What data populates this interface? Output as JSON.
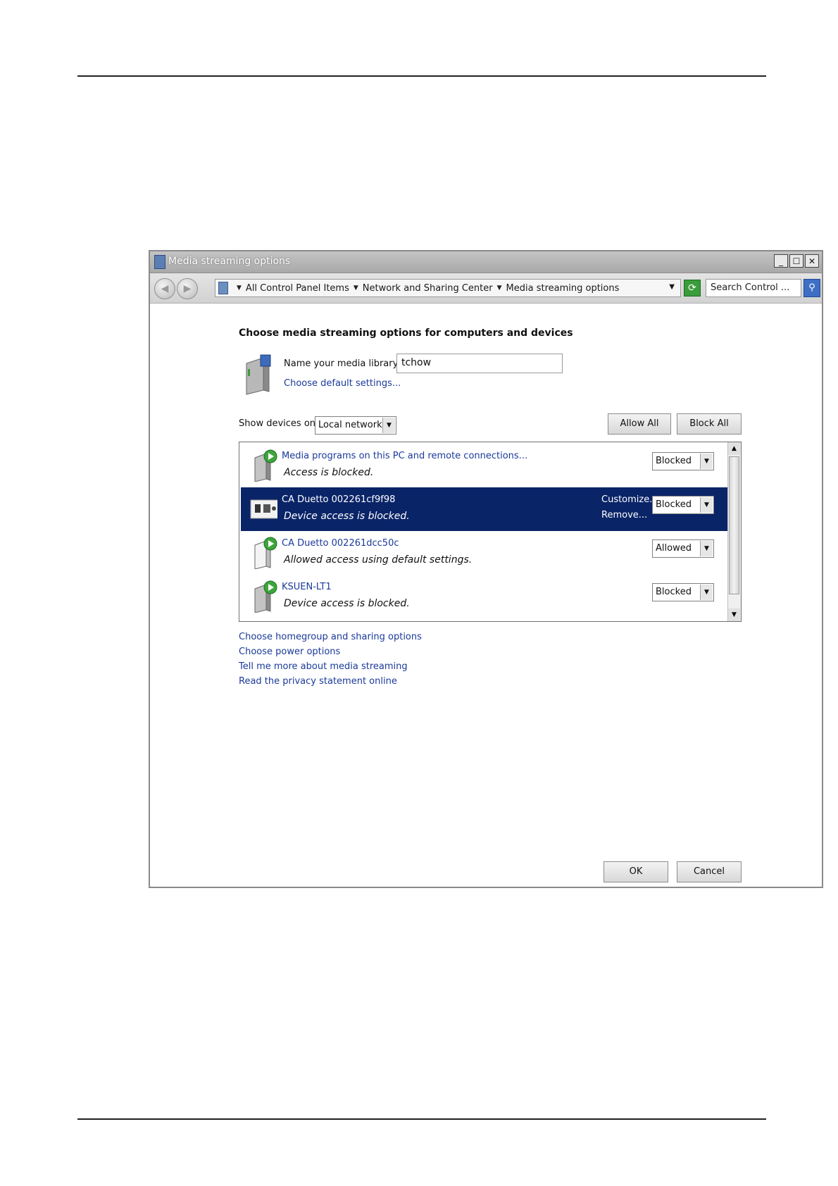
{
  "window": {
    "title": "Media streaming options",
    "controls": {
      "minimize": "_",
      "maximize": "☐",
      "close": "✕"
    }
  },
  "addressbar": {
    "breadcrumbs": [
      "All Control Panel Items",
      "Network and Sharing Center",
      "Media streaming options"
    ],
    "search_placeholder": "Search Control ..."
  },
  "main": {
    "heading": "Choose media streaming options for computers and devices",
    "library_label": "Name your media library:",
    "library_name": "tchow",
    "default_settings_link": "Choose default settings...",
    "show_devices_label": "Show devices on:",
    "show_devices_value": "Local network",
    "allow_all": "Allow All",
    "block_all": "Block All"
  },
  "devices": [
    {
      "name": "Media programs on this PC and remote connections...",
      "status": "Access is blocked.",
      "access": "Blocked",
      "selected": false
    },
    {
      "name": "CA Duetto 002261cf9f98",
      "status": "Device access is blocked.",
      "access": "Blocked",
      "selected": true,
      "customize": "Customize...",
      "remove": "Remove..."
    },
    {
      "name": "CA Duetto 002261dcc50c",
      "status": "Allowed access using default settings.",
      "access": "Allowed",
      "selected": false
    },
    {
      "name": "KSUEN-LT1",
      "status": "Device access is blocked.",
      "access": "Blocked",
      "selected": false
    }
  ],
  "links": [
    "Choose homegroup and sharing options",
    "Choose power options",
    "Tell me more about media streaming",
    "Read the privacy statement online"
  ],
  "footer": {
    "ok": "OK",
    "cancel": "Cancel"
  },
  "colors": {
    "selection": "#0a2468",
    "link": "#1a3a9a"
  }
}
